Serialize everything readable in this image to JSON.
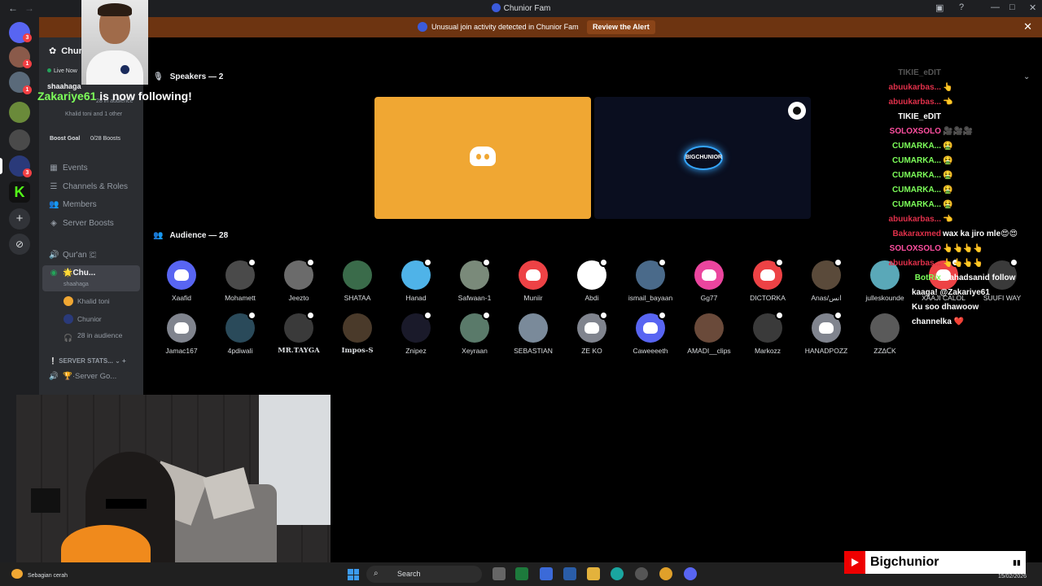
{
  "window": {
    "title": "Chunior Fam",
    "back": "←",
    "forward": "→"
  },
  "alert": {
    "text": "Unusual join activity detected in Chunior Fam",
    "button": "Review the Alert"
  },
  "sidebar": {
    "server_name": "Chur",
    "live": "Live Now",
    "host": "shaahaga",
    "audience_line": "28 in audience",
    "others_line": "Khalid toni and 1 other",
    "boost_label": "Boost Goal",
    "boost_count": "0/28 Boosts",
    "items": [
      {
        "label": "Events"
      },
      {
        "label": "Channels & Roles"
      },
      {
        "label": "Members"
      },
      {
        "label": "Server Boosts"
      }
    ],
    "voice_channel": "Qur'an 🇨",
    "stage_channel": "🌟Chu...",
    "stage_host": "shaahaga",
    "stage_members": [
      "Khalid toni",
      "Chunior"
    ],
    "stage_audience": "28 in audience",
    "category": "SERVER STATS...",
    "stat_channel": "🏆·Server Go..."
  },
  "overlay": {
    "follower": "Zakariye61",
    "follow_text": "is now following!"
  },
  "stage": {
    "speakers_label": "Speakers — 2",
    "audience_label": "Audience — 28",
    "speaker2_logo": "BIGCHUNIOR"
  },
  "audience": [
    {
      "name": "Xaafid",
      "color": "#5865f2",
      "disc": true
    },
    {
      "name": "Mohamett",
      "color": "#4a4a4a"
    },
    {
      "name": "Jeezto",
      "color": "#6b6b6b"
    },
    {
      "name": "SHATAA",
      "color": "#3a6b4a"
    },
    {
      "name": "Hanad",
      "color": "#4fb3e8"
    },
    {
      "name": "Safwaan-1",
      "color": "#7a8a7a"
    },
    {
      "name": "Muniir",
      "color": "#ed4245",
      "disc": true
    },
    {
      "name": "Abdi",
      "color": "#ffffff"
    },
    {
      "name": "ismail_bayaan",
      "color": "#4a6a8a"
    },
    {
      "name": "Gg77",
      "color": "#eb459e",
      "disc": true
    },
    {
      "name": "DICTORKA",
      "color": "#ed4245",
      "disc": true
    },
    {
      "name": "Anas/انس",
      "color": "#5a4a3a"
    },
    {
      "name": "julleskounde",
      "color": "#5aa8b8"
    },
    {
      "name": "XAAJI CALOL",
      "color": "#ed4245",
      "disc": true
    },
    {
      "name": "SUUFI WAY",
      "color": "#3a3a3a"
    },
    {
      "name": "Jamac167",
      "color": "#80848e",
      "disc": true
    },
    {
      "name": "4pdiwali",
      "color": "#2a4a5a"
    },
    {
      "name": "MR.TAYGA",
      "color": "#3a3a3a",
      "bold": true
    },
    {
      "name": "Impos-S",
      "color": "#4a3a2a",
      "bold": true
    },
    {
      "name": "Znipez",
      "color": "#1a1a2a"
    },
    {
      "name": "Xeyraan",
      "color": "#5a7a6a"
    },
    {
      "name": "SEBASTIAN",
      "color": "#7a8a9a"
    },
    {
      "name": "ZE KO",
      "color": "#80848e",
      "disc": true
    },
    {
      "name": "Caweeeeth",
      "color": "#5865f2",
      "disc": true
    },
    {
      "name": "AMADI__clips",
      "color": "#6a4a3a"
    },
    {
      "name": "Markozz",
      "color": "#3a3a3a"
    },
    {
      "name": "HANADPOZZ",
      "color": "#80848e",
      "disc": true
    },
    {
      "name": "ZZ∆ᑕK",
      "color": "#5a5a5a"
    }
  ],
  "chat": [
    {
      "user": "TIKIE_eDIT",
      "msg": "",
      "color": "#555555"
    },
    {
      "user": "abuukarbas...",
      "msg": "👆",
      "color": "#e0304a"
    },
    {
      "user": "abuukarbas...",
      "msg": "👈",
      "color": "#e0304a"
    },
    {
      "user": "TIKIE_eDIT",
      "msg": "",
      "color": "#ffffff"
    },
    {
      "user": "SOLOXSOLO",
      "msg": "🎥🎥🎥",
      "color": "#ff4fa0"
    },
    {
      "user": "CUMARKA...",
      "msg": "🤮",
      "color": "#7dff5a"
    },
    {
      "user": "CUMARKA...",
      "msg": "🤮",
      "color": "#7dff5a"
    },
    {
      "user": "CUMARKA...",
      "msg": "🤮",
      "color": "#7dff5a"
    },
    {
      "user": "CUMARKA...",
      "msg": "🤮",
      "color": "#7dff5a"
    },
    {
      "user": "CUMARKA...",
      "msg": "🤮",
      "color": "#7dff5a"
    },
    {
      "user": "abuukarbas...",
      "msg": "👈",
      "color": "#e0304a"
    },
    {
      "user": "Bakaraxmed",
      "msg": "wax ka jiro mle😍😍",
      "color": "#e0304a"
    },
    {
      "user": "SOLOXSOLO",
      "msg": "👆👆👆👆",
      "color": "#ff4fa0"
    },
    {
      "user": "abuukarbas...",
      "msg": "👆👆👆👆",
      "color": "#e0304a"
    },
    {
      "user": "BotRix",
      "msg": "Mahadsanid follow",
      "color": "#7dff5a"
    },
    {
      "user": "",
      "msg": "kaaga! @Zakariye61",
      "color": "#ffffff"
    },
    {
      "user": "",
      "msg": "Ku soo dhawoow",
      "color": "#ffffff"
    },
    {
      "user": "",
      "msg": "channelka ❤️",
      "color": "#ffffff"
    }
  ],
  "taskbar": {
    "weather": "Sebagian cerah",
    "search": "Search",
    "time": "15/02/2026"
  },
  "brand": {
    "name": "Bigchunior"
  }
}
